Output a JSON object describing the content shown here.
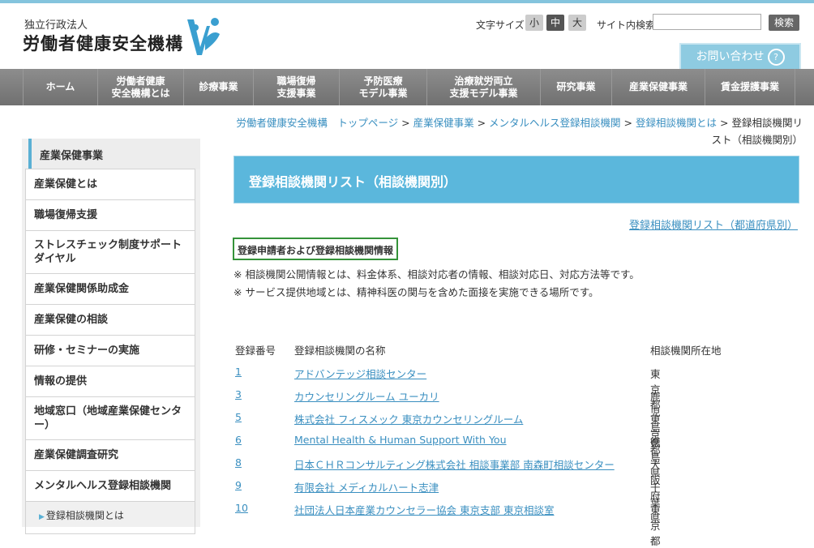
{
  "header": {
    "org_sub": "独立行政法人",
    "org_name": "労働者健康安全機構",
    "font_size_label": "文字サイズ",
    "font_sizes": [
      "小",
      "中",
      "大"
    ],
    "search_label": "サイト内検索",
    "search_value": "",
    "search_button": "検索",
    "contact_label": "お問い合わせ",
    "contact_icon": "?"
  },
  "nav": {
    "items": [
      {
        "label": "ホーム"
      },
      {
        "label": "労働者健康\n安全機構とは"
      },
      {
        "label": "診療事業"
      },
      {
        "label": "職場復帰\n支援事業"
      },
      {
        "label": "予防医療\nモデル事業"
      },
      {
        "label": "治療就労両立\n支援モデル事業"
      },
      {
        "label": "研究事業"
      },
      {
        "label": "産業保健事業"
      },
      {
        "label": "賃金援護事業"
      }
    ]
  },
  "breadcrumb": {
    "items": [
      "労働者健康安全機構　トップページ",
      "産業保健事業",
      "メンタルヘルス登録相談機関",
      "登録相談機関とは"
    ],
    "current": "登録相談機関リスト（相談機関別）",
    "separator": ">"
  },
  "sidebar": {
    "title": "産業保健事業",
    "items": [
      "産業保健とは",
      "職場復帰支援",
      "ストレスチェック制度サポートダイヤル",
      "産業保健関係助成金",
      "産業保健の相談",
      "研修・セミナーの実施",
      "情報の提供",
      "地域窓口（地域産業保健センター）",
      "産業保健調査研究",
      "メンタルヘルス登録相談機関"
    ],
    "sub_item": "登録相談機関とは"
  },
  "main": {
    "title": "登録相談機関リスト（相談機関別）",
    "pref_link": "登録相談機関リスト（都道府県別）",
    "info_box": "登録申請者および登録相談機関情報",
    "notes": [
      "※ 相談機関公開情報とは、料金体系、相談対応者の情報、相談対応日、対応方法等です。",
      "※ サービス提供地域とは、精神科医の関与を含めた面接を実施できる場所です。"
    ],
    "table": {
      "headers": [
        "登録番号",
        "登録相談機関の名称",
        "相談機関所在地"
      ],
      "rows": [
        {
          "num": "1",
          "name": "アドバンテッジ相談センター",
          "pref": "東京都"
        },
        {
          "num": "3",
          "name": "カウンセリングルーム ユーカリ",
          "pref": "鹿児島県"
        },
        {
          "num": "5",
          "name": "株式会社 フィスメック 東京カウンセリングルーム",
          "pref": "東京都"
        },
        {
          "num": "6",
          "name": "Mental Health & Human Support With You",
          "pref": "徳島県"
        },
        {
          "num": "8",
          "name": "日本ＣＨＲコンサルティング株式会社 相談事業部 南森町相談センター",
          "pref": "大阪府"
        },
        {
          "num": "9",
          "name": "有限会社 メディカルハート志津",
          "pref": "千葉県"
        },
        {
          "num": "10",
          "name": "社団法人日本産業カウンセラー協会 東京支部 東京相談室",
          "pref": "東京都"
        }
      ]
    }
  },
  "colors": {
    "accent": "#5bb7dc",
    "link": "#3a8fc0",
    "nav_bg": "#7d7d7d",
    "info_border": "#35933a"
  }
}
